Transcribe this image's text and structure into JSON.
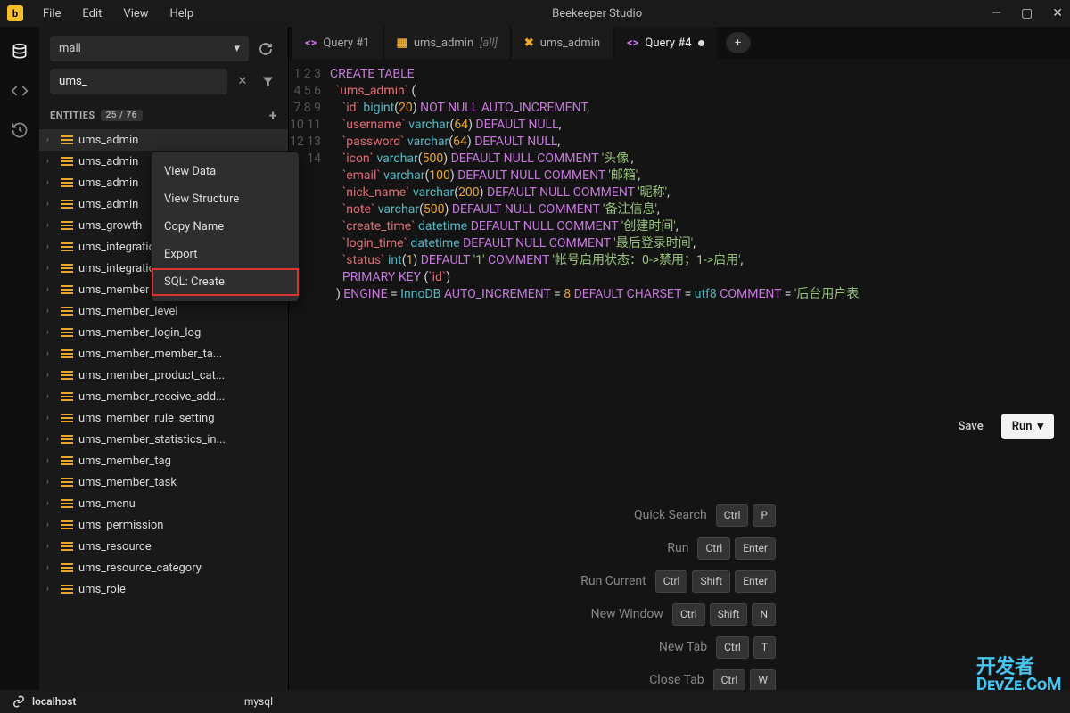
{
  "app": {
    "title": "Beekeeper Studio"
  },
  "menu": [
    "File",
    "Edit",
    "View",
    "Help"
  ],
  "sidebar": {
    "db_selected": "mall",
    "search_value": "ums_",
    "entities_label": "ENTITIES",
    "entities_count": "25 / 76",
    "items": [
      "ums_admin",
      "ums_admin",
      "ums_admin",
      "ums_admin",
      "ums_growth",
      "ums_integration",
      "ums_integration",
      "ums_member",
      "ums_member_level",
      "ums_member_login_log",
      "ums_member_member_ta...",
      "ums_member_product_cat...",
      "ums_member_receive_add...",
      "ums_member_rule_setting",
      "ums_member_statistics_in...",
      "ums_member_tag",
      "ums_member_task",
      "ums_menu",
      "ums_permission",
      "ums_resource",
      "ums_resource_category",
      "ums_role"
    ]
  },
  "context_menu": [
    "View Data",
    "View Structure",
    "Copy Name",
    "Export",
    "SQL: Create"
  ],
  "tabs": [
    {
      "icon": "query",
      "label": "Query #1"
    },
    {
      "icon": "table",
      "label": "ums_admin",
      "suffix": "[all]"
    },
    {
      "icon": "tools",
      "label": "ums_admin"
    },
    {
      "icon": "query",
      "label": "Query #4",
      "active": true,
      "dirty": true
    }
  ],
  "code_lines": [
    {
      "n": 1,
      "html": "<span class='kw'>CREATE</span> <span class='kw'>TABLE</span>"
    },
    {
      "n": 2,
      "html": "  <span class='ident'>`ums_admin`</span> ("
    },
    {
      "n": 3,
      "html": "    <span class='ident'>`id`</span> <span class='type'>bigint</span>(<span class='num'>20</span>) <span class='kw'>NOT</span> <span class='kw'>NULL</span> <span class='kw'>AUTO_INCREMENT</span>,"
    },
    {
      "n": 4,
      "html": "    <span class='ident'>`username`</span> <span class='type'>varchar</span>(<span class='num'>64</span>) <span class='kw'>DEFAULT</span> <span class='kw'>NULL</span>,"
    },
    {
      "n": 5,
      "html": "    <span class='ident'>`password`</span> <span class='type'>varchar</span>(<span class='num'>64</span>) <span class='kw'>DEFAULT</span> <span class='kw'>NULL</span>,"
    },
    {
      "n": 6,
      "html": "    <span class='ident'>`icon`</span> <span class='type'>varchar</span>(<span class='num'>500</span>) <span class='kw'>DEFAULT</span> <span class='kw'>NULL</span> <span class='kw'>COMMENT</span> <span class='comment-str'>'头像'</span>,"
    },
    {
      "n": 7,
      "html": "    <span class='ident'>`email`</span> <span class='type'>varchar</span>(<span class='num'>100</span>) <span class='kw'>DEFAULT</span> <span class='kw'>NULL</span> <span class='kw'>COMMENT</span> <span class='comment-str'>'邮箱'</span>,"
    },
    {
      "n": 8,
      "html": "    <span class='ident'>`nick_name`</span> <span class='type'>varchar</span>(<span class='num'>200</span>) <span class='kw'>DEFAULT</span> <span class='kw'>NULL</span> <span class='kw'>COMMENT</span> <span class='comment-str'>'昵称'</span>,"
    },
    {
      "n": 9,
      "html": "    <span class='ident'>`note`</span> <span class='type'>varchar</span>(<span class='num'>500</span>) <span class='kw'>DEFAULT</span> <span class='kw'>NULL</span> <span class='kw'>COMMENT</span> <span class='comment-str'>'备注信息'</span>,"
    },
    {
      "n": 10,
      "html": "    <span class='ident'>`create_time`</span> <span class='type'>datetime</span> <span class='kw'>DEFAULT</span> <span class='kw'>NULL</span> <span class='kw'>COMMENT</span> <span class='comment-str'>'创建时间'</span>,"
    },
    {
      "n": 11,
      "html": "    <span class='ident'>`login_time`</span> <span class='type'>datetime</span> <span class='kw'>DEFAULT</span> <span class='kw'>NULL</span> <span class='kw'>COMMENT</span> <span class='comment-str'>'最后登录时间'</span>,"
    },
    {
      "n": 12,
      "html": "    <span class='ident'>`status`</span> <span class='type'>int</span>(<span class='num'>1</span>) <span class='kw'>DEFAULT</span> <span class='comment-str'>'1'</span> <span class='kw'>COMMENT</span> <span class='comment-str'>'帐号启用状态：0-&gt;禁用；1-&gt;启用'</span>,"
    },
    {
      "n": 13,
      "html": "    <span class='kw'>PRIMARY</span> <span class='kw'>KEY</span> (<span class='ident'>`id`</span>)"
    },
    {
      "n": 14,
      "html": "  ) <span class='kw'>ENGINE</span> = <span class='type'>InnoDB</span> <span class='kw'>AUTO_INCREMENT</span> = <span class='num'>8</span> <span class='kw'>DEFAULT</span> <span class='kw'>CHARSET</span> = <span class='type'>utf8</span> <span class='kw'>COMMENT</span> = <span class='comment-str'>'后台用户表'</span>"
    }
  ],
  "actions": {
    "save": "Save",
    "run": "Run"
  },
  "shortcuts": [
    {
      "label": "Quick Search",
      "keys": [
        "Ctrl",
        "P"
      ]
    },
    {
      "label": "Run",
      "keys": [
        "Ctrl",
        "Enter"
      ]
    },
    {
      "label": "Run Current",
      "keys": [
        "Ctrl",
        "Shift",
        "Enter"
      ]
    },
    {
      "label": "New Window",
      "keys": [
        "Ctrl",
        "Shift",
        "N"
      ]
    },
    {
      "label": "New Tab",
      "keys": [
        "Ctrl",
        "T"
      ]
    },
    {
      "label": "Close Tab",
      "keys": [
        "Ctrl",
        "W"
      ]
    }
  ],
  "status": {
    "host": "localhost",
    "engine": "mysql"
  },
  "watermark": {
    "l1": "开发者",
    "l2": "DᴇᴠZᴇ.CᴏM"
  }
}
